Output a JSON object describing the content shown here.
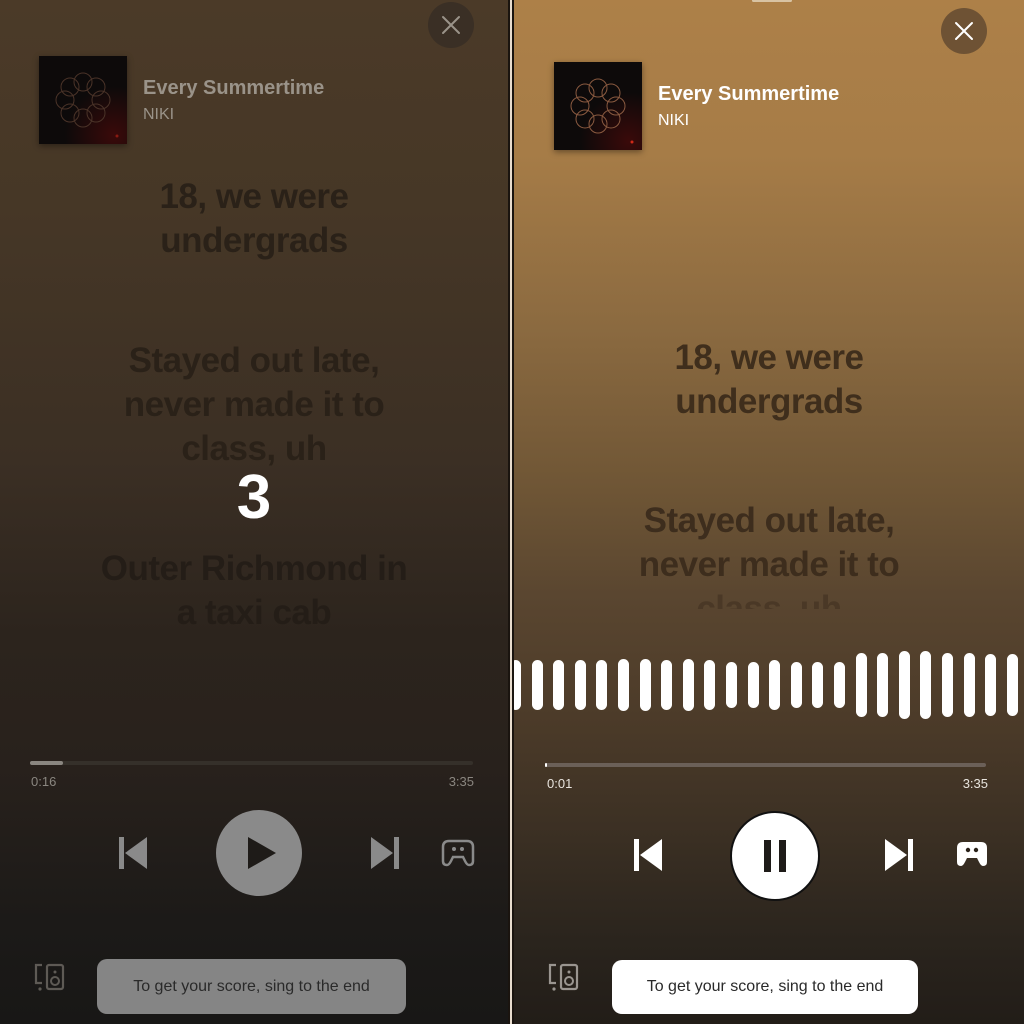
{
  "left_panel": {
    "state": "countdown",
    "song": {
      "title": "Every Summertime",
      "artist": "NIKI"
    },
    "lyrics": [
      "18, we were",
      "undergrads",
      "Stayed out late,",
      "never made it to",
      "class, uh",
      "Outer Richmond in",
      "a taxi cab"
    ],
    "countdown": "3",
    "progress": {
      "elapsed": "0:16",
      "duration": "3:35",
      "fraction": 0.074
    },
    "controls": {
      "previous_icon": "skip-previous-icon",
      "play_icon": "play-icon",
      "next_icon": "skip-next-icon",
      "game_icon": "gamepad-icon"
    },
    "devices_icon": "connect-devices-icon",
    "toast": "To get your score, sing to the end",
    "close_icon": "close-icon"
  },
  "right_panel": {
    "state": "playing",
    "song": {
      "title": "Every Summertime",
      "artist": "NIKI"
    },
    "lyrics": [
      "18, we were",
      "undergrads",
      "Stayed out late,",
      "never made it to",
      "class, uh"
    ],
    "voice_meter_levels": [
      0.55,
      0.55,
      0.55,
      0.55,
      0.55,
      0.58,
      0.58,
      0.55,
      0.58,
      0.55,
      0.52,
      0.52,
      0.55,
      0.52,
      0.52,
      0.52,
      0.72,
      0.72,
      0.76,
      0.76,
      0.72,
      0.72,
      0.68,
      0.68,
      0.7
    ],
    "progress": {
      "elapsed": "0:01",
      "duration": "3:35",
      "fraction": 0.005
    },
    "controls": {
      "previous_icon": "skip-previous-icon",
      "pause_icon": "pause-icon",
      "next_icon": "skip-next-icon",
      "game_icon": "gamepad-icon"
    },
    "devices_icon": "connect-devices-icon",
    "toast": "To get your score, sing to the end",
    "close_icon": "close-icon"
  },
  "colors": {
    "left_text_dim": "#9a9389",
    "lyric_inactive_left": "#2a2118",
    "lyric_inactive_right": "#3f2e1c",
    "control_gray": "#8a8a8a",
    "white": "#ffffff"
  }
}
